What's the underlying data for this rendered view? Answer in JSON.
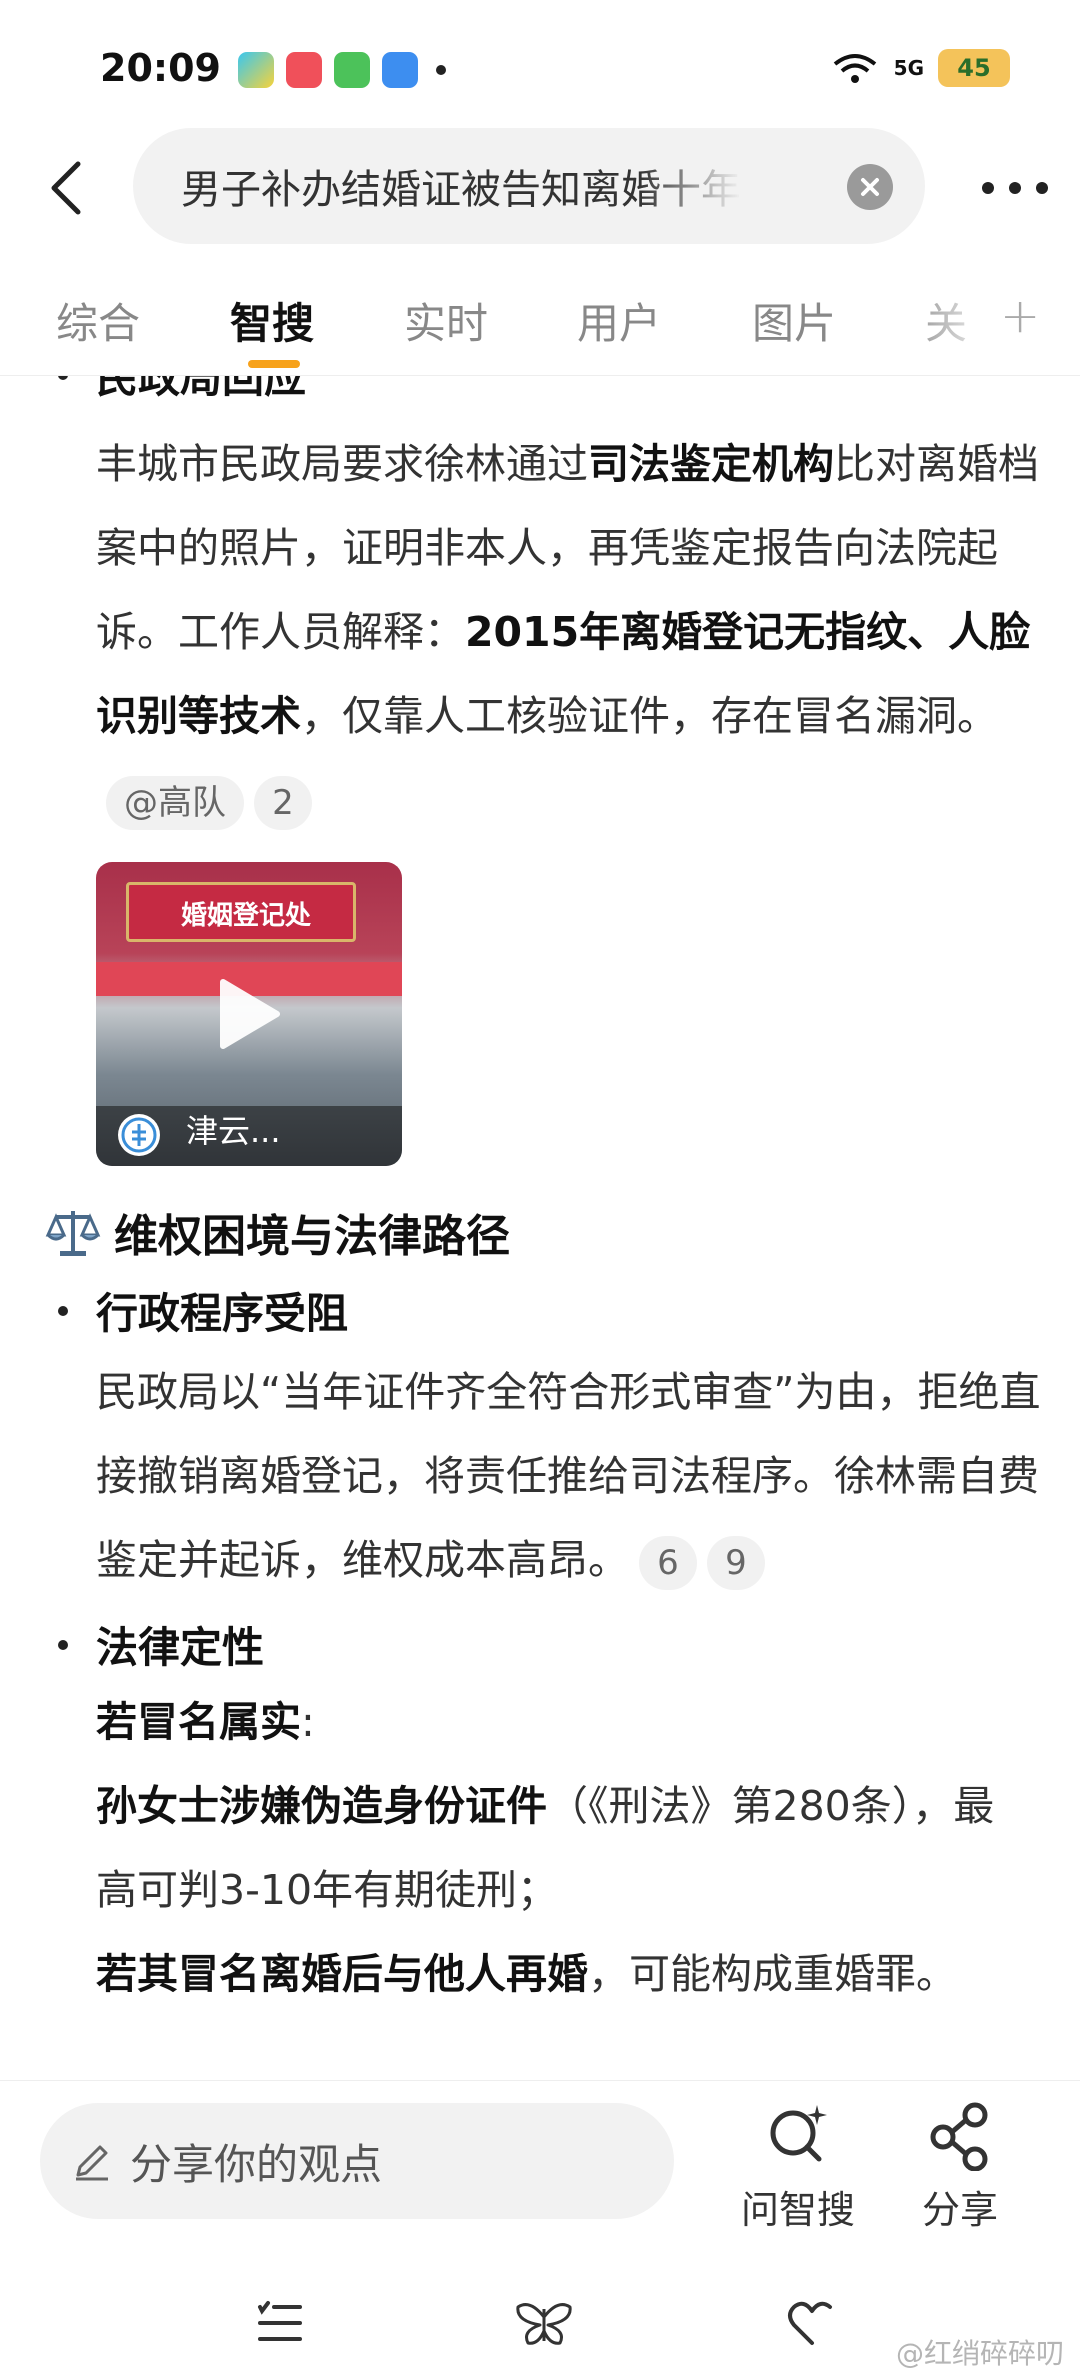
{
  "status_bar": {
    "time": "20:09",
    "network": "5G",
    "battery": "45"
  },
  "search": {
    "query": "男子补办结婚证被告知离婚十年"
  },
  "tabs": [
    {
      "label": "综合",
      "active": false
    },
    {
      "label": "智搜",
      "active": true
    },
    {
      "label": "实时",
      "active": false
    },
    {
      "label": "用户",
      "active": false
    },
    {
      "label": "图片",
      "active": false
    },
    {
      "label": "关",
      "active": false
    }
  ],
  "content": {
    "partial_heading": "民政局回应",
    "para1": {
      "t1": "丰城市民政局要求徐林通过",
      "b1": "司法鉴定机构",
      "t2": "比对离婚档案中的照片，证明非本人，再凭鉴定报告向法院起诉。工作人员解释：",
      "b2": "2015年离婚登记无指纹、人脸识别等技术",
      "t3": "，仅靠人工核验证件，存在冒名漏洞。",
      "ref_user": "@高队",
      "ref_num": "2"
    },
    "video": {
      "sign": "婚姻登记处",
      "title": "津云..."
    },
    "section_title": "维权困境与法律路径",
    "section_icon": "balance-scale",
    "bullet2": {
      "heading": "行政程序受阻",
      "text": "民政局以“当年证件齐全符合形式审查”为由，拒绝直接撤销离婚登记，将责任推给司法程序。徐林需自费鉴定并起诉，维权成本高昂。",
      "ref1": "6",
      "ref2": "9"
    },
    "bullet3": {
      "heading": "法律定性",
      "if_label": "若冒名属实",
      "colon": ":",
      "line1_bold": "孙女士涉嫌伪造身份证件",
      "line1_rest": "（《刑法》第280条），最高可判3-10年有期徒刑；",
      "line2_bold": "若其冒名离婚后与他人再婚",
      "line2_rest": "，可能构成重婚罪。"
    }
  },
  "bottom": {
    "share_placeholder": "分享你的观点",
    "ask_label": "问智搜",
    "share_label": "分享"
  },
  "watermark": "@红绡碎碎叨"
}
